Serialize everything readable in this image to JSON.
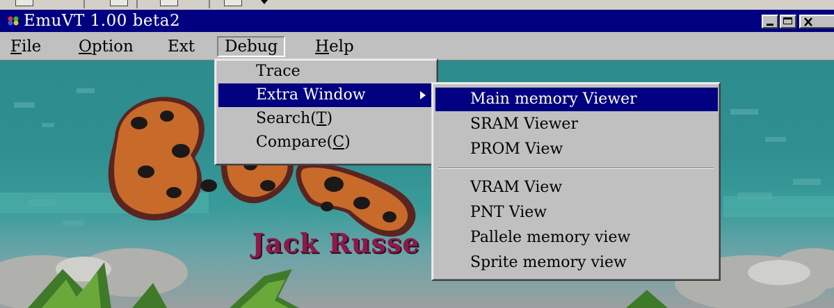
{
  "window": {
    "title": "EmuVT 1.00 beta2",
    "controls": {
      "minimize": "_",
      "close": "×"
    }
  },
  "menubar": {
    "items": [
      {
        "label": "File",
        "mnemonic": "F",
        "rest": "ile"
      },
      {
        "label": "Option",
        "mnemonic": "O",
        "rest": "ption"
      },
      {
        "label": "Ext",
        "mnemonic": "",
        "rest": "Ext"
      },
      {
        "label": "Debug",
        "mnemonic": "",
        "rest": "Debug"
      },
      {
        "label": "Help",
        "mnemonic": "H",
        "rest": "elp"
      }
    ],
    "active": "Debug"
  },
  "debug_menu": {
    "items": [
      {
        "label": "Trace"
      },
      {
        "label": "Extra Window",
        "submenu": true
      },
      {
        "label": "Search(T)",
        "prefix": "Search(",
        "mnemonic": "T",
        "suffix": ")"
      },
      {
        "label": "Compare(C)",
        "prefix": "Compare(",
        "mnemonic": "C",
        "suffix": ")"
      }
    ],
    "highlighted": "Extra Window"
  },
  "extra_window_menu": {
    "items": [
      {
        "label": "Main memory Viewer"
      },
      {
        "label": "SRAM Viewer"
      },
      {
        "label": "PROM View"
      },
      {
        "label": "VRAM View"
      },
      {
        "label": "PNT View"
      },
      {
        "label": "Pallele memory view"
      },
      {
        "label": "Sprite memory view"
      }
    ],
    "highlighted": "Main memory Viewer"
  },
  "game": {
    "logo_text": "Jack Russe"
  },
  "colors": {
    "title_bar": "#000080",
    "menu_face": "#c0c0c0",
    "highlight": "#000080",
    "logo_text": "#8b1a4a"
  }
}
